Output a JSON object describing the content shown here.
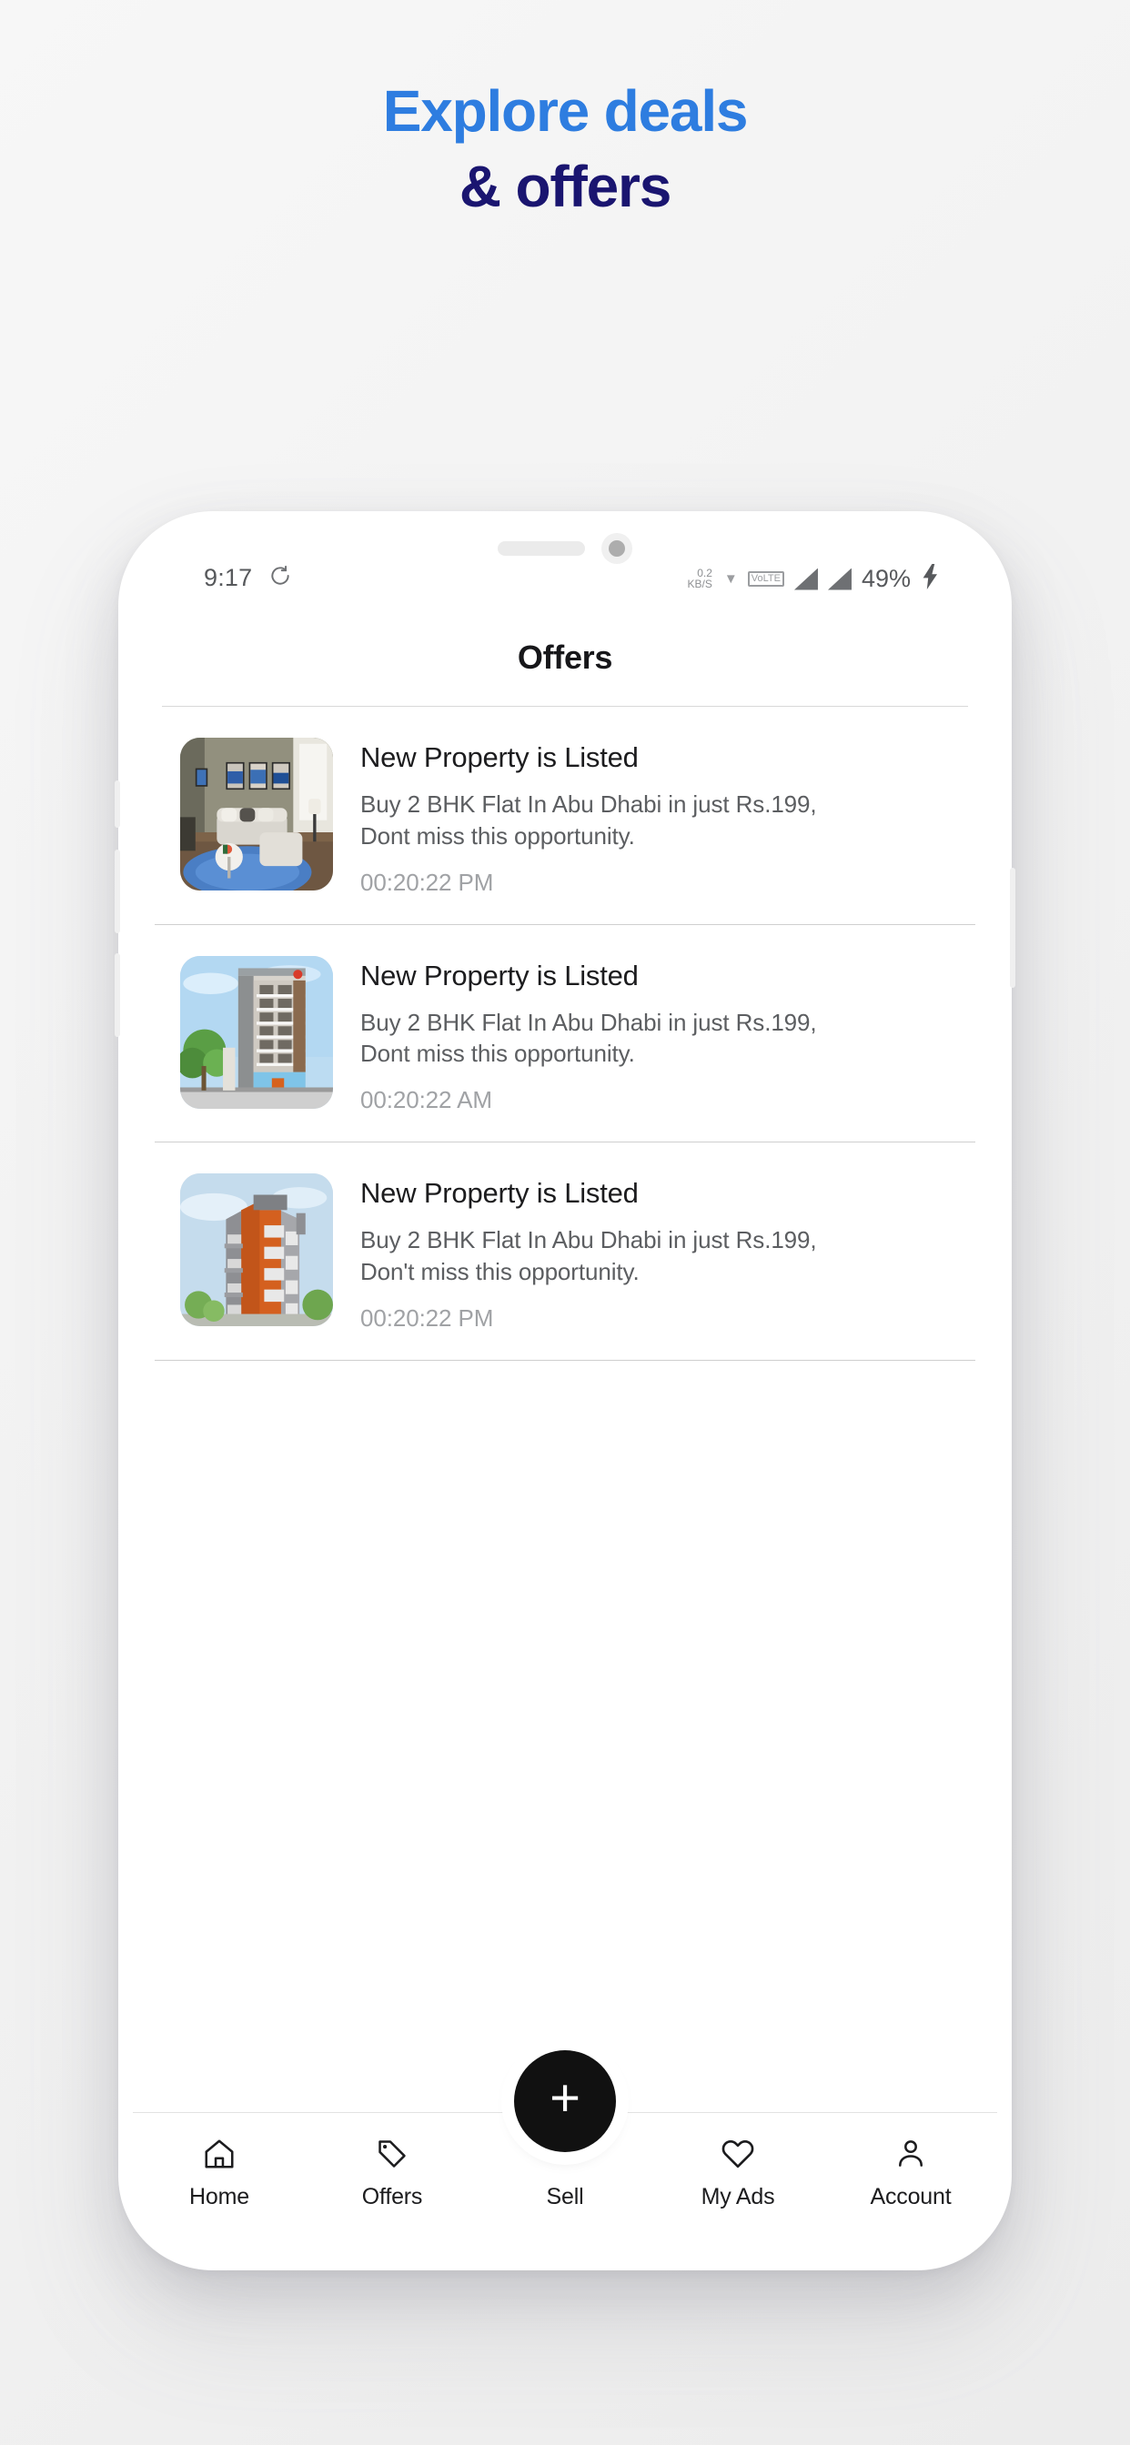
{
  "promo": {
    "line1": "Explore deals",
    "line2": "& offers",
    "color_line1": "#2e7de0",
    "color_line2": "#1a1570"
  },
  "status_bar": {
    "time": "9:17",
    "alarm_icon": "alarm-icon",
    "net_speed_value": "0.2",
    "net_speed_unit": "KB/S",
    "battery": "49%",
    "charging_icon": "charging-bolt-icon",
    "signal_icon": "signal-bars-icon",
    "vowifi_label": "VoLTE"
  },
  "header": {
    "title": "Offers"
  },
  "offers": [
    {
      "title": "New Property is Listed",
      "description": "Buy 2 BHK Flat In Abu Dhabi in just Rs.199, Dont miss this opportunity.",
      "time": "00:20:22 PM",
      "thumbnail": "living-room-interior-photo"
    },
    {
      "title": "New Property is Listed",
      "description": "Buy 2 BHK Flat In Abu Dhabi in just Rs.199, Dont miss this opportunity.",
      "time": "00:20:22 AM",
      "thumbnail": "tall-apartment-building-photo"
    },
    {
      "title": "New Property is Listed",
      "description": "Buy 2 BHK Flat In Abu Dhabi in just Rs.199, Don't miss this opportunity.",
      "time": "00:20:22 PM",
      "thumbnail": "orange-apartment-building-photo"
    }
  ],
  "bottom_nav": {
    "items": [
      {
        "label": "Home",
        "icon": "home-icon"
      },
      {
        "label": "Offers",
        "icon": "tag-icon"
      },
      {
        "label": "Sell",
        "icon": "plus-icon"
      },
      {
        "label": "My Ads",
        "icon": "heart-icon"
      },
      {
        "label": "Account",
        "icon": "person-icon"
      }
    ],
    "fab_symbol": "+"
  }
}
